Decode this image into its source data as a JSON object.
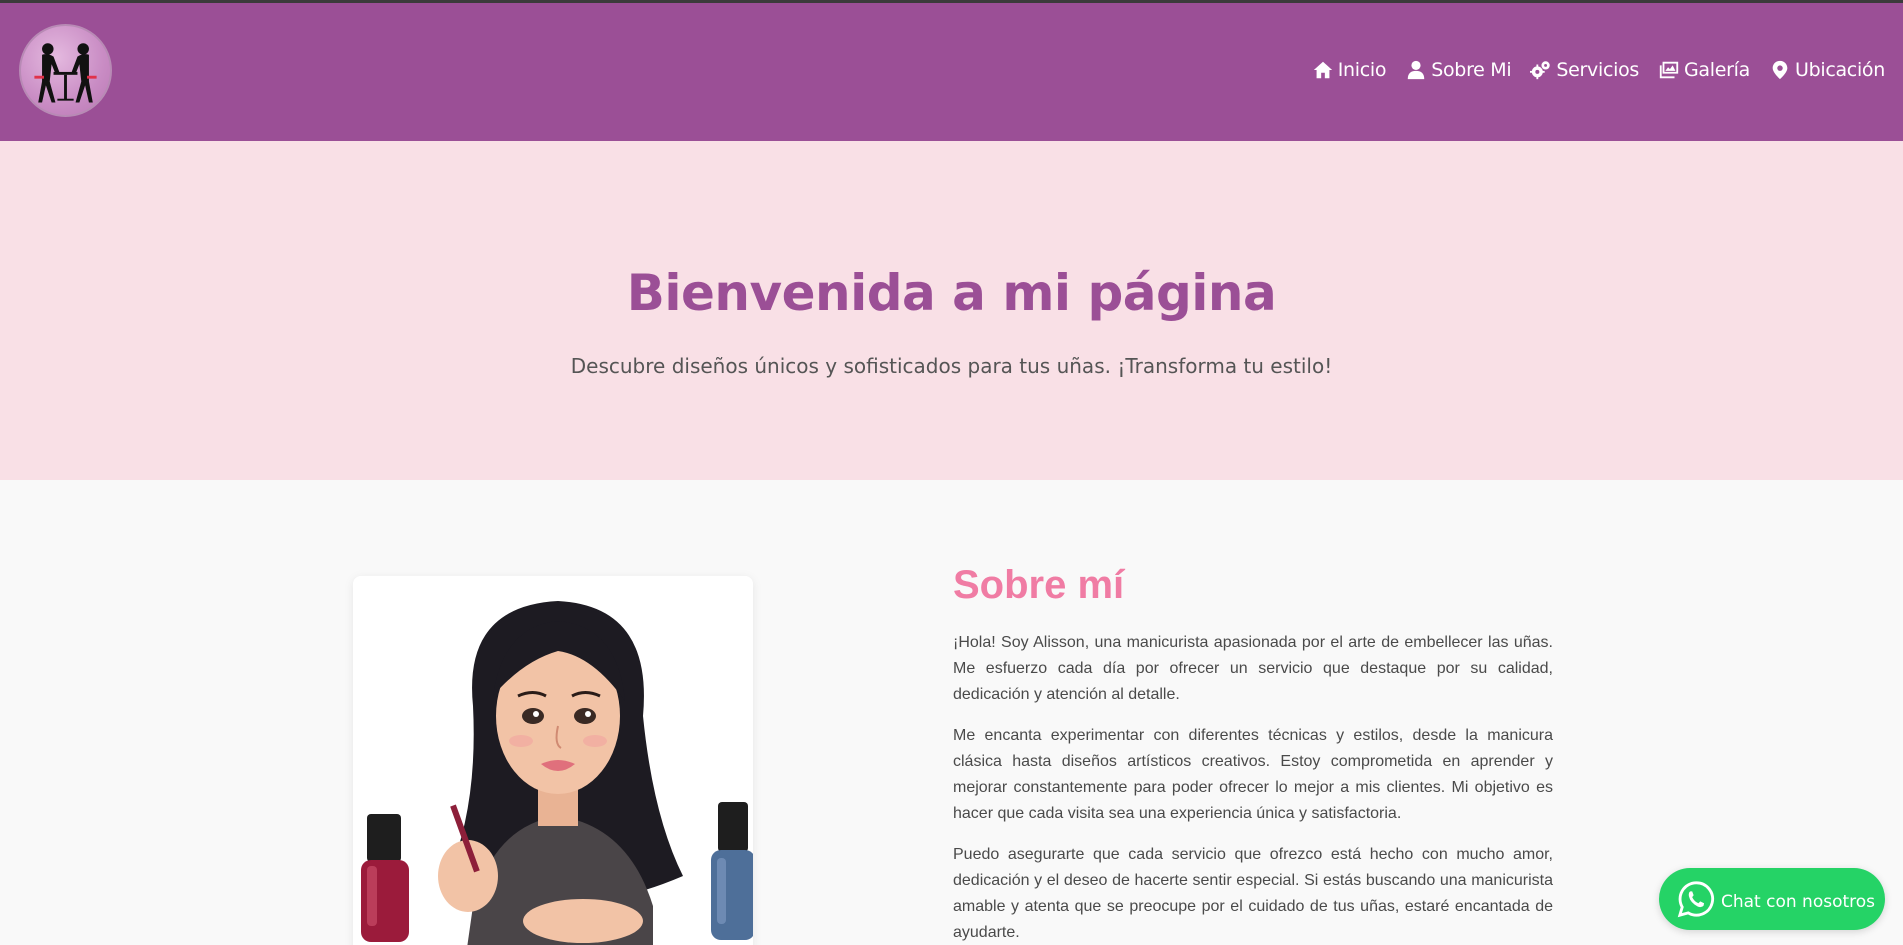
{
  "colors": {
    "header_bg": "#9b4f96",
    "hero_bg": "#f9e0e6",
    "hero_title": "#9b4f96",
    "about_title": "#f07ca4",
    "whatsapp": "#25d366"
  },
  "header": {
    "logo_icon": "manicure-salon-logo",
    "nav": [
      {
        "label": "Inicio",
        "icon": "home-icon"
      },
      {
        "label": "Sobre Mi",
        "icon": "user-icon"
      },
      {
        "label": "Servicios",
        "icon": "gears-icon"
      },
      {
        "label": "Galería",
        "icon": "images-icon"
      },
      {
        "label": "Ubicación",
        "icon": "map-pin-icon"
      }
    ]
  },
  "hero": {
    "title": "Bienvenida a mi página",
    "subtitle": "Descubre diseños únicos y sofisticados para tus uñas. ¡Transforma tu estilo!"
  },
  "about": {
    "image_icon": "manicurist-illustration",
    "title": "Sobre mí",
    "paragraphs": [
      "¡Hola! Soy Alisson, una manicurista apasionada por el arte de embellecer las uñas. Me esfuerzo cada día por ofrecer un servicio que destaque por su calidad, dedicación y atención al detalle.",
      "Me encanta experimentar con diferentes técnicas y estilos, desde la manicura clásica hasta diseños artísticos creativos. Estoy comprometida en aprender y mejorar constantemente para poder ofrecer lo mejor a mis clientes. Mi objetivo es hacer que cada visita sea una experiencia única y satisfactoria.",
      "Puedo asegurarte que cada servicio que ofrezco está hecho con mucho amor, dedicación y el deseo de hacerte sentir especial. Si estás buscando una manicurista amable y atenta que se preocupe por el cuidado de tus uñas, estaré encantada de ayudarte."
    ]
  },
  "whatsapp": {
    "label": "Chat con nosotros",
    "icon": "whatsapp-icon"
  }
}
